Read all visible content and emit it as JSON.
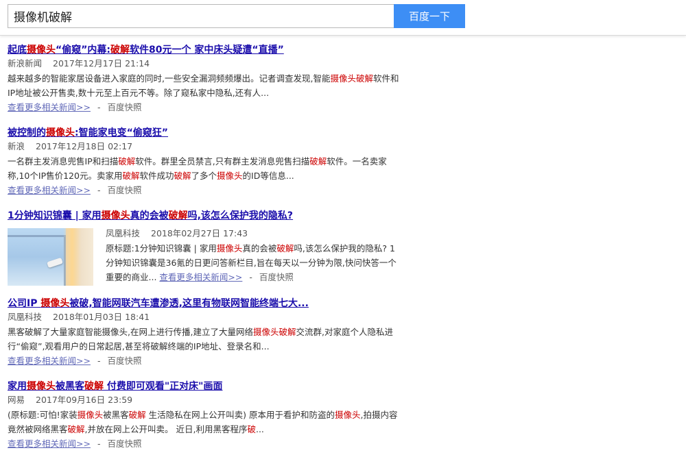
{
  "search": {
    "query": "摄像机破解",
    "button_label": "百度一下"
  },
  "common": {
    "more_news": "查看更多相关新闻>>",
    "separator": "-",
    "snapshot": "百度快照"
  },
  "results": [
    {
      "title": [
        {
          "t": "起底",
          "hl": false
        },
        {
          "t": "摄像头",
          "hl": true
        },
        {
          "t": "“偷窥”内幕:",
          "hl": false
        },
        {
          "t": "破解",
          "hl": true
        },
        {
          "t": "软件80元一个 家中床头疑遭“直播”",
          "hl": false
        }
      ],
      "source": "新浪新闻",
      "date": "2017年12月17日 21:14",
      "abstract": [
        {
          "t": "越来越多的智能家居设备进入家庭的同时,一些安全漏洞频频爆出。记者调查发现,智能",
          "hl": false
        },
        {
          "t": "摄像头",
          "hl": true
        },
        {
          "t": "破解",
          "hl": true
        },
        {
          "t": "软件和IP地址被公开售卖,数十元至上百元不等。除了窥私家中隐私,还有人...",
          "hl": false
        }
      ]
    },
    {
      "title": [
        {
          "t": "被控制的",
          "hl": false
        },
        {
          "t": "摄像头",
          "hl": true
        },
        {
          "t": ":智能家电变“偷窥狂”",
          "hl": false
        }
      ],
      "source": "新浪",
      "date": "2017年12月18日 02:17",
      "abstract": [
        {
          "t": "一名群主发消息兜售IP和扫描",
          "hl": false
        },
        {
          "t": "破解",
          "hl": true
        },
        {
          "t": "软件。群里全员禁言,只有群主发消息兜售扫描",
          "hl": false
        },
        {
          "t": "破解",
          "hl": true
        },
        {
          "t": "软件。一名卖家称,10个IP售价120元。卖家用",
          "hl": false
        },
        {
          "t": "破解",
          "hl": true
        },
        {
          "t": "软件成功",
          "hl": false
        },
        {
          "t": "破解",
          "hl": true
        },
        {
          "t": "了多个",
          "hl": false
        },
        {
          "t": "摄像头",
          "hl": true
        },
        {
          "t": "的ID等信息...",
          "hl": false
        }
      ]
    },
    {
      "title": [
        {
          "t": "1分钟知识锦囊 | 家用",
          "hl": false
        },
        {
          "t": "摄像头",
          "hl": true
        },
        {
          "t": "真的会被",
          "hl": false
        },
        {
          "t": "破解",
          "hl": true
        },
        {
          "t": "吗,该怎么保护我的隐私?",
          "hl": false
        }
      ],
      "source": "凤凰科技",
      "date": "2018年02月27日 17:43",
      "abstract": [
        {
          "t": "原标题:1分钟知识锦囊 | 家用",
          "hl": false
        },
        {
          "t": "摄像头",
          "hl": true
        },
        {
          "t": "真的会被",
          "hl": false
        },
        {
          "t": "破解",
          "hl": true
        },
        {
          "t": "吗,该怎么保护我的隐私? 1分钟知识锦囊是36氪的日更问答新栏目,旨在每天以一分钟为限,快问快答一个重要的商业...",
          "hl": false
        }
      ]
    },
    {
      "title": [
        {
          "t": "公司IP ",
          "hl": false
        },
        {
          "t": "摄像头",
          "hl": true
        },
        {
          "t": "被破,智能网联汽车遭渗透,这里有物联网智能终端七大...",
          "hl": false
        }
      ],
      "source": "凤凰科技",
      "date": "2018年01月03日 18:41",
      "abstract": [
        {
          "t": "黑客破解了大量家庭智能摄像头,在网上进行传播,建立了大量网络",
          "hl": false
        },
        {
          "t": "摄像头破解",
          "hl": true
        },
        {
          "t": "交流群,对家庭个人隐私进行“偷窥”,观看用户的日常起居,甚至将破解终端的IP地址、登录名和...",
          "hl": false
        }
      ]
    },
    {
      "title": [
        {
          "t": "家用",
          "hl": false
        },
        {
          "t": "摄像头",
          "hl": true
        },
        {
          "t": "被黑客",
          "hl": false
        },
        {
          "t": "破解",
          "hl": true
        },
        {
          "t": " 付费即可观看\"正对床\"画面",
          "hl": false
        }
      ],
      "source": "网易",
      "date": "2017年09月16日 23:59",
      "abstract": [
        {
          "t": "(原标题:可怕!家装",
          "hl": false
        },
        {
          "t": "摄像头",
          "hl": true
        },
        {
          "t": "被黑客",
          "hl": false
        },
        {
          "t": "破解",
          "hl": true
        },
        {
          "t": " 生活隐私在网上公开叫卖) 原本用于看护和防盗的",
          "hl": false
        },
        {
          "t": "摄像头",
          "hl": true
        },
        {
          "t": ",拍摄内容竟然被网络黑客",
          "hl": false
        },
        {
          "t": "破解",
          "hl": true
        },
        {
          "t": ",并放在网上公开叫卖。 近日,利用黑客程序",
          "hl": false
        },
        {
          "t": "破",
          "hl": true
        },
        {
          "t": "...",
          "hl": false
        }
      ]
    }
  ]
}
